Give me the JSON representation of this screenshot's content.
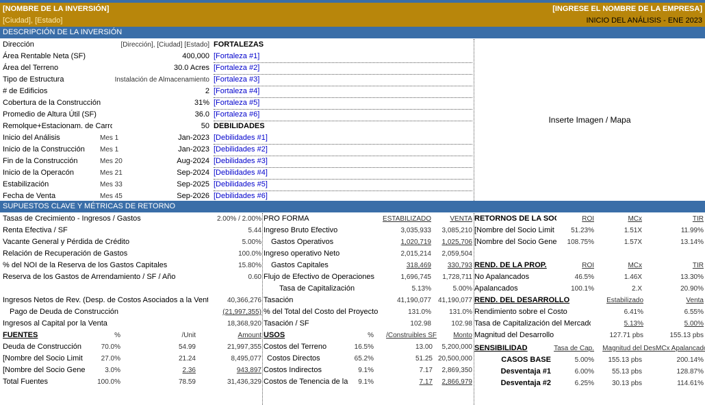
{
  "header": {
    "investment_name": "[NOMBRE DE LA INVERSIÓN]",
    "company_name": "[INGRESE EL NOMBRE DE LA EMPRESA]",
    "city_state": "[Ciudad], [Estado]",
    "analysis_start": "INICIO DEL ANÁLISIS - ENE 2023"
  },
  "description": {
    "title": "DESCRIPCIÓN DE LA INVERSIÓN",
    "rows": [
      {
        "label": "Dirección",
        "sub": "",
        "value": "[Dirección], [Ciudad] [Estado]"
      },
      {
        "label": "Área Rentable Neta (SF)",
        "sub": "",
        "value": "400,000"
      },
      {
        "label": "Área del Terreno",
        "sub": "",
        "value": "30.0 Acres"
      },
      {
        "label": "Tipo de Estructura",
        "sub": "",
        "value": "Instalación de Almacenamiento"
      },
      {
        "label": "# de Edificios",
        "sub": "",
        "value": "2"
      },
      {
        "label": "Cobertura de la Construcción",
        "sub": "",
        "value": "31%"
      },
      {
        "label": "Promedio de Altura Útil (SF)",
        "sub": "",
        "value": "36.0"
      },
      {
        "label": "Remolque+Estacionam. de Carros",
        "sub": "",
        "value": "50"
      },
      {
        "label": "Inicio del Análisis",
        "sub": "Mes 1",
        "value": "Jan-2023"
      },
      {
        "label": "Inicio de la Construcción",
        "sub": "Mes 1",
        "value": "Jan-2023"
      },
      {
        "label": "Fin de la Construcción",
        "sub": "Mes 20",
        "value": "Aug-2024"
      },
      {
        "label": "Inicio de la Operacón",
        "sub": "Mes 21",
        "value": "Sep-2024"
      },
      {
        "label": "Estabilización",
        "sub": "Mes 33",
        "value": "Sep-2025"
      },
      {
        "label": "Fecha de Venta",
        "sub": "Mes 45",
        "value": "Sep-2026"
      }
    ],
    "strengths_title": "FORTALEZAS",
    "strengths": [
      "[Fortaleza #1]",
      "[Fortaleza #2]",
      "[Fortaleza #3]",
      "[Fortaleza #4]",
      "[Fortaleza #5]",
      "[Fortaleza #6]"
    ],
    "weaknesses_title": "DEBILIDADES",
    "weaknesses": [
      "[Debilidades #1]",
      "[Debilidades #2]",
      "[Debilidades #3]",
      "[Debilidades #4]",
      "[Debilidades #5]",
      "[Debilidades #6]"
    ],
    "image_placeholder": "Inserte Imagen / Mapa"
  },
  "assumptions": {
    "title": "SUPUESTOS CLAVE Y MÉTRICAS DE RETORNO",
    "rows": [
      {
        "label": "Tasas de Crecimiento - Ingresos / Gastos",
        "value": "2.00% / 2.00%"
      },
      {
        "label": "Renta Efectiva / SF",
        "value": "5.44"
      },
      {
        "label": "Vacante General y Pérdida de Crédito",
        "value": "5.00%"
      },
      {
        "label": "Relación de Recuperación de Gastos",
        "value": "100.0%"
      },
      {
        "label": "% del NOI de la Reserva de los Gastos Capitales",
        "value": "15.80%"
      },
      {
        "label": "Reserva de los Gastos de Arrendamiento / SF / Año",
        "value": "0.60"
      }
    ],
    "rows2": [
      {
        "label": "Ingresos Netos de Rev. (Desp. de Costos Asociados a la Venta)",
        "value": "40,366,276"
      },
      {
        "label": "Pago de Deuda de Construcción",
        "value": "(21,997,355)"
      },
      {
        "label": "Ingresos al Capital por la Venta",
        "value": "18,368,920"
      }
    ]
  },
  "proforma": {
    "title": "PRO FORMA",
    "col1": "ESTABILIZADO",
    "col2": "VENTA",
    "rows": [
      {
        "label": "Ingreso Bruto Efectivo",
        "a": "3,035,933",
        "b": "3,085,210"
      },
      {
        "label": "Gastos Operativos",
        "a": "1,020,719",
        "b": "1,025,706"
      },
      {
        "label": "Ingreso operativo Neto",
        "a": "2,015,214",
        "b": "2,059,504"
      },
      {
        "label": "Gastos Capitales",
        "a": "318,469",
        "b": "330,793"
      },
      {
        "label": "Flujo de Efectivo de Operaciones",
        "a": "1,696,745",
        "b": "1,728,711"
      },
      {
        "label": "Tasa de Capitalización",
        "a": "5.13%",
        "b": "5.00%"
      },
      {
        "label": "Tasación",
        "a": "41,190,077",
        "b": "41,190,077"
      },
      {
        "label": "% del Total del Costo del Proyecto",
        "a": "131.0%",
        "b": "131.0%"
      },
      {
        "label": "Tasación / SF",
        "a": "102.98",
        "b": "102.98"
      }
    ]
  },
  "partner_returns": {
    "title": "RETORNOS DE LA SOC.",
    "h1": "ROI",
    "h2": "MCx",
    "h3": "TIR",
    "rows": [
      {
        "label": "[Nombre del Socio Limit",
        "a": "51.23%",
        "b": "1.51X",
        "c": "11.99%"
      },
      {
        "label": "[Nombre del Socio Gene",
        "a": "108.75%",
        "b": "1.57X",
        "c": "13.14%"
      }
    ]
  },
  "property_returns": {
    "title": "REND. DE LA PROP.",
    "h1": "ROI",
    "h2": "MCx",
    "h3": "TIR",
    "rows": [
      {
        "label": "No Apalancados",
        "a": "46.5%",
        "b": "1.46X",
        "c": "13.30%"
      },
      {
        "label": "Apalancados",
        "a": "100.1%",
        "b": "2.X",
        "c": "20.90%"
      }
    ]
  },
  "development_returns": {
    "title": "REND. DEL DESARROLLO",
    "h1": "Estabilizado",
    "h2": "Venta",
    "rows": [
      {
        "label": "Rendimiento sobre el Costo",
        "a": "6.41%",
        "b": "6.55%"
      },
      {
        "label": "Tasa de Capitalización del Mercado",
        "a": "5.13%",
        "b": "5.00%"
      },
      {
        "label": "Magnitud del Desarrollo",
        "a": "127.71 pbs",
        "b": "155.13 pbs"
      }
    ]
  },
  "sources": {
    "title": "FUENTES",
    "h1": "%",
    "h2": "/Unit",
    "h3": "Amount",
    "rows": [
      {
        "label": "Deuda de Construcción",
        "a": "70.0%",
        "b": "54.99",
        "c": "21,997,355"
      },
      {
        "label": "[Nombre del Socio Limit",
        "a": "27.0%",
        "b": "21.24",
        "c": "8,495,077"
      },
      {
        "label": "[Nombre del Socio Gene",
        "a": "3.0%",
        "b": "2.36",
        "c": "943,897"
      },
      {
        "label": "Total Fuentes",
        "a": "100.0%",
        "b": "78.59",
        "c": "31,436,329"
      }
    ]
  },
  "uses": {
    "title": "USOS",
    "h1": "%",
    "h2": "/Construibles SF",
    "h3": "Monto",
    "rows": [
      {
        "label": "Costos del Terreno",
        "a": "16.5%",
        "b": "13.00",
        "c": "5,200,000"
      },
      {
        "label": "Costos Directos",
        "a": "65.2%",
        "b": "51.25",
        "c": "20,500,000"
      },
      {
        "label": "Costos Indirectos",
        "a": "9.1%",
        "b": "7.17",
        "c": "2,869,350"
      },
      {
        "label": "Costos de Tenencia de la",
        "a": "9.1%",
        "b": "7.17",
        "c": "2,866,979"
      }
    ]
  },
  "sensitivity": {
    "title": "SENSIBILIDAD",
    "h1": "Tasa de Cap.",
    "h2": "Magnitud del Des",
    "h3": "MCx Apalancado",
    "rows": [
      {
        "label": "CASOS BASE",
        "a": "5.00%",
        "b": "155.13 pbs",
        "c": "200.14%"
      },
      {
        "label": "Desventaja #1",
        "a": "6.00%",
        "b": "55.13 pbs",
        "c": "128.87%"
      },
      {
        "label": "Desventaja #2",
        "a": "6.25%",
        "b": "30.13 pbs",
        "c": "114.61%"
      }
    ]
  }
}
